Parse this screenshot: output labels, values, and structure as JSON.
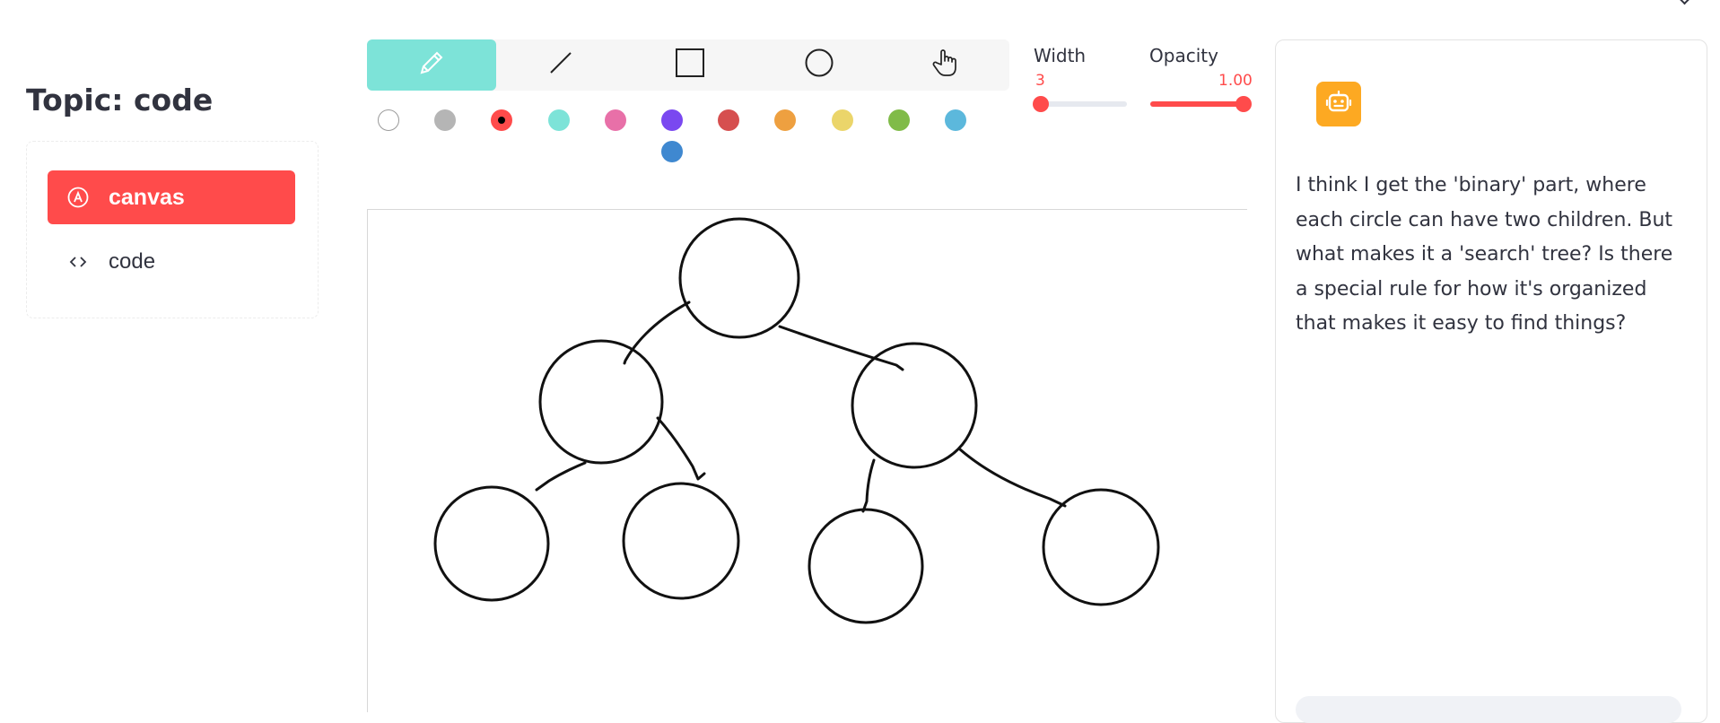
{
  "sidebar": {
    "topic_title": "Topic: code",
    "items": [
      {
        "label": "canvas",
        "icon": "pen-circle-icon",
        "active": true
      },
      {
        "label": "code",
        "icon": "code-brackets-icon",
        "active": false
      }
    ]
  },
  "toolbar": {
    "tools": [
      {
        "name": "freedraw",
        "icon": "pencil-icon",
        "active": true
      },
      {
        "name": "line",
        "icon": "line-icon",
        "active": false
      },
      {
        "name": "rect",
        "icon": "rectangle-icon",
        "active": false
      },
      {
        "name": "circle",
        "icon": "circle-icon",
        "active": false
      },
      {
        "name": "transform",
        "icon": "hand-pointer-icon",
        "active": false
      }
    ],
    "colors": [
      "#ffffff",
      "#b5b5b5",
      "#ff4b4b",
      "#7de3d8",
      "#e870a8",
      "#7a48f0",
      "#d64f4f",
      "#eea040",
      "#ebd56a",
      "#80bb48",
      "#5cb8dc",
      "#3f88d0"
    ],
    "selected_color": "#ff4b4b",
    "accent_color": "#ff4b4b",
    "width": {
      "label": "Width",
      "value": "3",
      "fraction": 0.0
    },
    "opacity": {
      "label": "Opacity",
      "value": "1.00",
      "fraction": 1.0
    }
  },
  "chat": {
    "avatar_icon": "robot-icon",
    "message": "I think I get the 'binary' part, where each circle can have two children. But what makes it a 'search' tree? Is there a special rule for how it's organized that makes it easy to find things?"
  }
}
